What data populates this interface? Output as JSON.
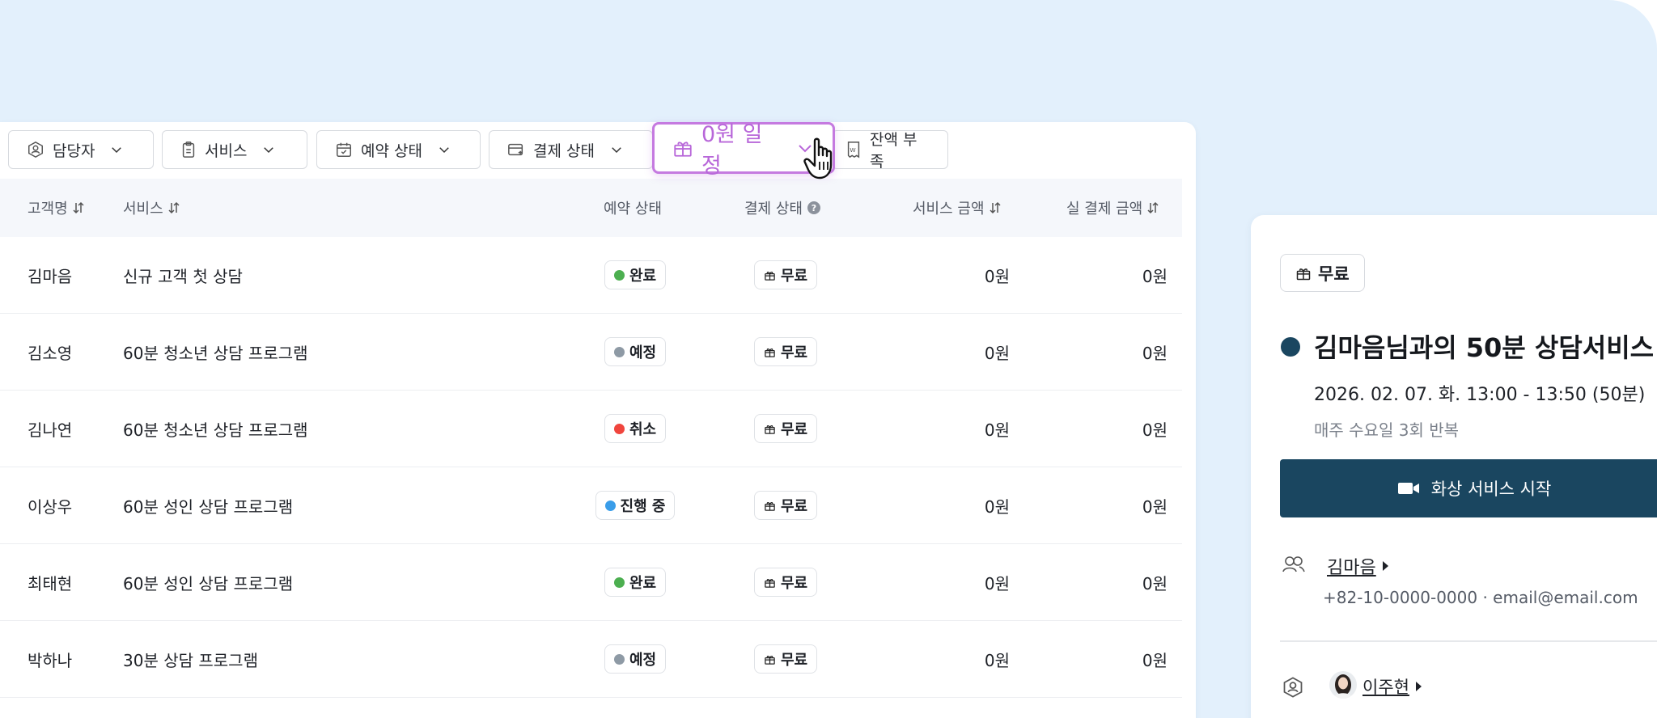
{
  "filters": {
    "staff": "담당자",
    "service": "서비스",
    "reservation_status": "예약 상태",
    "payment_status": "결제 상태",
    "zero_won": "0원 일정",
    "low_balance": "잔액 부족"
  },
  "table": {
    "headers": {
      "customer": "고객명",
      "service": "서비스",
      "reservation_status": "예약 상태",
      "payment_status": "결제 상태",
      "service_amount": "서비스 금액",
      "paid_amount": "실 결제 금액"
    },
    "rows": [
      {
        "customer": "김마음",
        "service": "신규 고객 첫 상담",
        "status": "완료",
        "status_color": "#4caf50",
        "payment": "무료",
        "amount": "0원",
        "paid": "0원"
      },
      {
        "customer": "김소영",
        "service": "60분 청소년 상담 프로그램",
        "status": "예정",
        "status_color": "#8e9aa5",
        "payment": "무료",
        "amount": "0원",
        "paid": "0원"
      },
      {
        "customer": "김나연",
        "service": "60분 청소년 상담 프로그램",
        "status": "취소",
        "status_color": "#f0453d",
        "payment": "무료",
        "amount": "0원",
        "paid": "0원"
      },
      {
        "customer": "이상우",
        "service": "60분 성인 상담 프로그램",
        "status": "진행 중",
        "status_color": "#3a9de9",
        "payment": "무료",
        "amount": "0원",
        "paid": "0원"
      },
      {
        "customer": "최태현",
        "service": "60분 성인 상담 프로그램",
        "status": "완료",
        "status_color": "#4caf50",
        "payment": "무료",
        "amount": "0원",
        "paid": "0원"
      },
      {
        "customer": "박하나",
        "service": "30분 상담 프로그램",
        "status": "예정",
        "status_color": "#8e9aa5",
        "payment": "무료",
        "amount": "0원",
        "paid": "0원"
      }
    ]
  },
  "detail": {
    "badge": "무료",
    "title": "김마음님과의 50분 상담서비스",
    "datetime": "2026. 02. 07. 화. 13:00 - 13:50 (50분)",
    "repeat": "매주 수요일 3회 반복",
    "start_button": "화상 서비스 시작",
    "client_name": "김마음",
    "contact": "+82-10-0000-0000 · email@email.com",
    "staff_name": "이주현"
  },
  "colors": {
    "background": "#e3f0fc",
    "accent": "#c57ae0",
    "primary": "#1a4660"
  }
}
